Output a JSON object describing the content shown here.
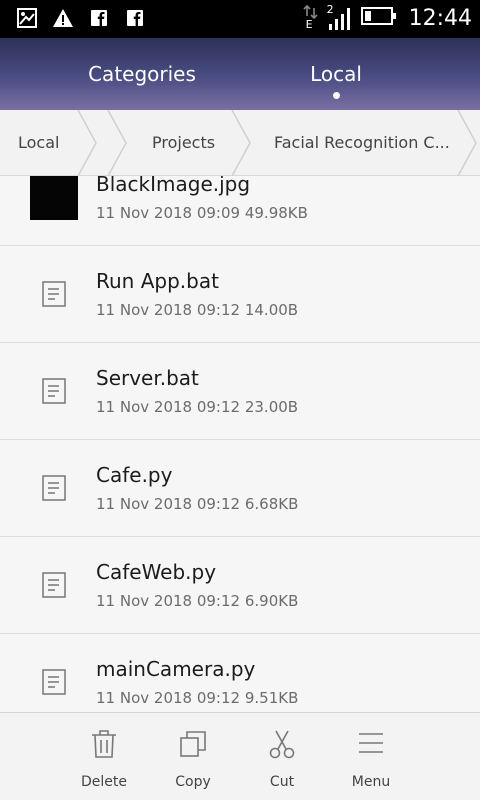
{
  "status_bar": {
    "time": "12:44",
    "network_type": "E",
    "sim_slot": "2",
    "icons": [
      "gallery-icon",
      "alert-icon",
      "facebook-icon",
      "facebook-icon",
      "data-arrows-icon",
      "signal-icon",
      "battery-icon"
    ]
  },
  "header": {
    "tabs": [
      {
        "label": "Categories",
        "active": false
      },
      {
        "label": "Local",
        "active": true
      }
    ]
  },
  "breadcrumb": {
    "items": [
      "Local",
      "Projects",
      "Facial Recognition C..."
    ]
  },
  "files": [
    {
      "name": "BlackImage.jpg",
      "meta": "11 Nov 2018 09:09 49.98KB",
      "icon": "image-thumbnail"
    },
    {
      "name": "Run App.bat",
      "meta": "11 Nov 2018 09:12 14.00B",
      "icon": "document-icon"
    },
    {
      "name": "Server.bat",
      "meta": "11 Nov 2018 09:12 23.00B",
      "icon": "document-icon"
    },
    {
      "name": "Cafe.py",
      "meta": "11 Nov 2018 09:12 6.68KB",
      "icon": "document-icon"
    },
    {
      "name": "CafeWeb.py",
      "meta": "11 Nov 2018 09:12 6.90KB",
      "icon": "document-icon"
    },
    {
      "name": "mainCamera.py",
      "meta": "11 Nov 2018 09:12 9.51KB",
      "icon": "document-icon"
    }
  ],
  "toolbar": {
    "delete_label": "Delete",
    "copy_label": "Copy",
    "cut_label": "Cut",
    "menu_label": "Menu"
  },
  "colors": {
    "header_top": "#2e3159",
    "header_bottom": "#7b6fa3",
    "status_bar": "#000000",
    "background": "#f6f6f6"
  }
}
